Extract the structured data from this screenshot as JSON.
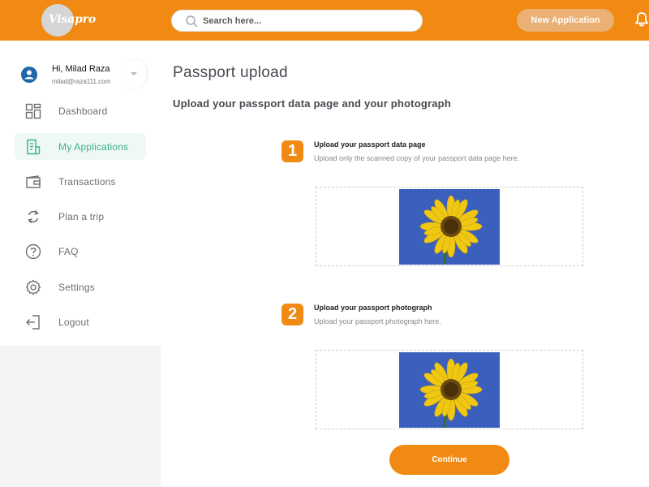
{
  "header": {
    "logo_text": "Visapro",
    "search_placeholder": "Search here...",
    "new_application_label": "New Application",
    "accent_color": "#f08a12"
  },
  "user": {
    "greeting": "Hi,",
    "name": "Milad Raza",
    "email": "milad@raza111.com"
  },
  "sidebar": {
    "items": [
      {
        "label": "Dashboard",
        "icon": "dashboard-icon",
        "active": false
      },
      {
        "label": "My Applications",
        "icon": "applications-icon",
        "active": true
      },
      {
        "label": "Transactions",
        "icon": "wallet-icon",
        "active": false
      },
      {
        "label": "Plan a trip",
        "icon": "refresh-icon",
        "active": false
      },
      {
        "label": "FAQ",
        "icon": "question-icon",
        "active": false
      },
      {
        "label": "Settings",
        "icon": "gear-icon",
        "active": false
      },
      {
        "label": "Logout",
        "icon": "logout-icon",
        "active": false
      }
    ],
    "active_color": "#3cb08c"
  },
  "main": {
    "title": "Passport upload",
    "subtitle": "Upload your passport data page and your photograph",
    "steps": [
      {
        "number": "1",
        "title": "Upload your passport data page",
        "description": "Upload only the scanned copy of your passport data page here.",
        "image": "sunflower-image"
      },
      {
        "number": "2",
        "title": "Upload your passport photograph",
        "description": "Upload your passport photograph here.",
        "image": "sunflower-image"
      }
    ],
    "continue_label": "Continue"
  }
}
